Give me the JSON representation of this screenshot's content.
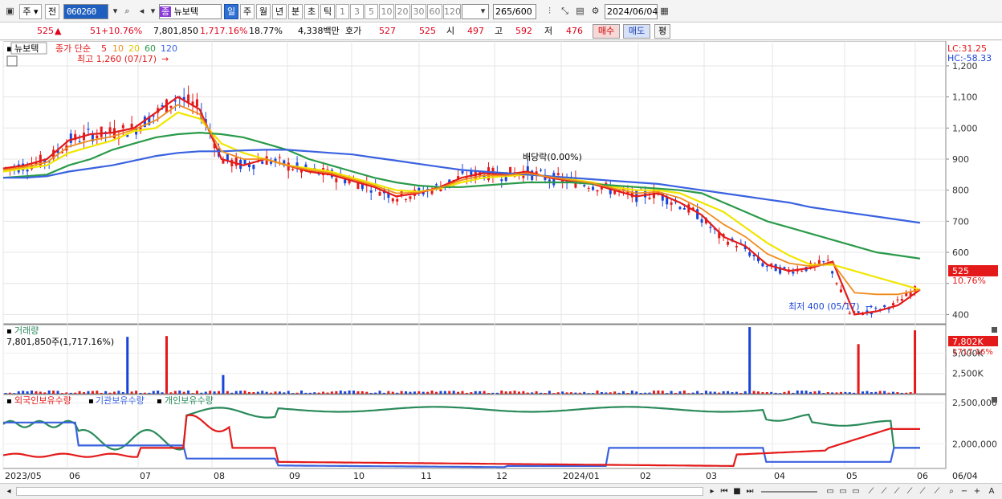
{
  "toolbar": {
    "type_label": "주",
    "prev_label": "전",
    "code": "060260",
    "stock_name": "뉴보텍",
    "stock_badge": "종",
    "periods": [
      "일",
      "주",
      "월",
      "년",
      "분",
      "초",
      "틱"
    ],
    "selected_period": "일",
    "intervals": [
      "1",
      "3",
      "5",
      "10",
      "20",
      "30",
      "60",
      "120"
    ],
    "count": "265",
    "count_max": "/600",
    "date": "2024/06/04"
  },
  "quote": {
    "price": "525",
    "arrow": "▲",
    "change": "51",
    "change_pct": "+10.76%",
    "volume": "7,801,850",
    "volume_ratio": "1,717.16%",
    "turnover": "18.77%",
    "amount": "4,338백만",
    "hoga_label": "호가",
    "ask": "527",
    "bid": "525",
    "open_label": "시",
    "open": "497",
    "high_label": "고",
    "high": "592",
    "low_label": "저",
    "low": "476",
    "buy_label": "매수",
    "sell_label": "매도",
    "avg_label": "평"
  },
  "price_panel": {
    "title": "뉴보텍",
    "ma_title": "종가 단순",
    "ma_periods": [
      "5",
      "10",
      "20",
      "60",
      "120"
    ],
    "ma_colors": [
      "#e41a1a",
      "#f08c1e",
      "#f0e600",
      "#2a9a4a",
      "#3a62e0"
    ],
    "high_note": "최고 1,260 (07/17)",
    "low_note": "최저 400 (05/17)",
    "div_note": "배당락(0.00%)",
    "lc": "LC:31.25",
    "hc": "HC:-58.33",
    "last_price_tag": "525",
    "last_change_tag": "10.76%"
  },
  "volume_panel": {
    "title": "거래량",
    "subtitle": "7,801,850주(1,717.16%)",
    "last_tag": "7,802K",
    "last_pct_tag": "1717.16%"
  },
  "holding_panel": {
    "legend": [
      "외국인보유수량",
      "기관보유수량",
      "개인보유수량"
    ],
    "colors": [
      "#e41a1a",
      "#3a62e0",
      "#2a8a5a"
    ]
  },
  "chart_data": [
    {
      "type": "line",
      "name": "price",
      "y_ticks": [
        1200,
        1100,
        1000,
        900,
        800,
        700,
        600,
        500,
        400
      ],
      "y_tick_labels": [
        "1,200",
        "1,100",
        "1,000",
        "900",
        "800",
        "700",
        "600",
        "",
        "400"
      ],
      "ylim": [
        370,
        1280
      ],
      "x_labels": [
        "2023/05",
        "06",
        "07",
        "08",
        "09",
        "10",
        "11",
        "12",
        "2024/01",
        "02",
        "03",
        "04",
        "05",
        "06"
      ],
      "x_end_label": "06/04",
      "series": [
        {
          "name": "5",
          "values": [
            870,
            880,
            900,
            960,
            980,
            985,
            1000,
            1050,
            1100,
            1060,
            900,
            880,
            900,
            880,
            860,
            850,
            830,
            810,
            780,
            790,
            810,
            840,
            855,
            850,
            860,
            840,
            830,
            820,
            800,
            780,
            790,
            760,
            720,
            650,
            620,
            560,
            540,
            550,
            570,
            400,
            410,
            430,
            480
          ]
        },
        {
          "name": "20",
          "values": [
            860,
            870,
            880,
            920,
            940,
            960,
            990,
            1000,
            1050,
            1030,
            950,
            920,
            900,
            880,
            870,
            860,
            840,
            820,
            800,
            795,
            805,
            825,
            840,
            845,
            850,
            845,
            835,
            825,
            810,
            800,
            800,
            790,
            760,
            730,
            680,
            630,
            590,
            560,
            560,
            540,
            520,
            500,
            480
          ]
        },
        {
          "name": "60",
          "values": [
            840,
            845,
            850,
            880,
            900,
            930,
            950,
            970,
            980,
            985,
            980,
            970,
            950,
            930,
            900,
            880,
            860,
            840,
            825,
            815,
            810,
            810,
            815,
            820,
            825,
            825,
            825,
            820,
            815,
            810,
            805,
            800,
            790,
            760,
            730,
            700,
            680,
            660,
            640,
            620,
            600,
            590,
            580
          ]
        },
        {
          "name": "120",
          "values": [
            840,
            840,
            845,
            860,
            870,
            880,
            895,
            910,
            920,
            925,
            925,
            928,
            930,
            930,
            925,
            920,
            915,
            905,
            895,
            885,
            875,
            865,
            860,
            855,
            850,
            845,
            840,
            835,
            830,
            825,
            820,
            810,
            800,
            790,
            780,
            770,
            760,
            745,
            735,
            725,
            715,
            705,
            695
          ]
        }
      ]
    },
    {
      "type": "bar",
      "name": "volume",
      "y_ticks": [
        5000,
        2500
      ],
      "y_tick_labels": [
        "5,000K",
        "2,500K"
      ],
      "ylim": [
        0,
        8500
      ]
    },
    {
      "type": "line",
      "name": "holdings",
      "y_ticks": [
        2500000,
        2000000
      ],
      "y_tick_labels": [
        "2,500,000",
        "2,000,000"
      ]
    }
  ],
  "statusbar": {
    "icons": [
      "scroll-left",
      "scroll-right",
      "rewind",
      "stop",
      "fast-forward",
      "zoom-out",
      "zoom-in"
    ]
  }
}
